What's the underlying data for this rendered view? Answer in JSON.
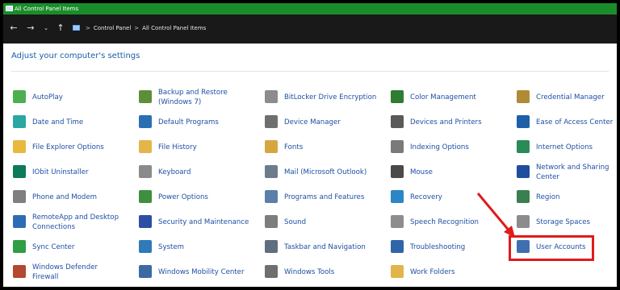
{
  "window": {
    "title": "All Control Panel Items"
  },
  "navigation": {
    "back_glyph": "←",
    "forward_glyph": "→",
    "recent_glyph": "⌄",
    "up_glyph": "↑",
    "breadcrumb": [
      "Control Panel",
      "All Control Panel Items"
    ],
    "separator": ">"
  },
  "main": {
    "heading": "Adjust your computer's settings",
    "items": [
      {
        "label": "AutoPlay",
        "label2": "",
        "icon": "autoplay-icon",
        "color": "#4caf50"
      },
      {
        "label": "Backup and Restore",
        "label2": "(Windows 7)",
        "icon": "backup-icon",
        "color": "#5d8f3a"
      },
      {
        "label": "BitLocker Drive Encryption",
        "label2": "",
        "icon": "bitlocker-icon",
        "color": "#8c8c8c"
      },
      {
        "label": "Color Management",
        "label2": "",
        "icon": "color-management-icon",
        "color": "#2e7d32"
      },
      {
        "label": "Credential Manager",
        "label2": "",
        "icon": "credential-icon",
        "color": "#b08a34"
      },
      {
        "label": "Date and Time",
        "label2": "",
        "icon": "clock-icon",
        "color": "#2aa7a1"
      },
      {
        "label": "Default Programs",
        "label2": "",
        "icon": "default-programs-icon",
        "color": "#2b6fb3"
      },
      {
        "label": "Device Manager",
        "label2": "",
        "icon": "device-manager-icon",
        "color": "#6f6f6f"
      },
      {
        "label": "Devices and Printers",
        "label2": "",
        "icon": "printer-icon",
        "color": "#5a5a5a"
      },
      {
        "label": "Ease of Access Center",
        "label2": "",
        "icon": "accessibility-icon",
        "color": "#1e5fa8"
      },
      {
        "label": "File Explorer Options",
        "label2": "",
        "icon": "folder-icon",
        "color": "#e8b93c"
      },
      {
        "label": "File History",
        "label2": "",
        "icon": "file-history-icon",
        "color": "#e3b54a"
      },
      {
        "label": "Fonts",
        "label2": "",
        "icon": "fonts-icon",
        "color": "#d7a640"
      },
      {
        "label": "Indexing Options",
        "label2": "",
        "icon": "indexing-icon",
        "color": "#7a7a7a"
      },
      {
        "label": "Internet Options",
        "label2": "",
        "icon": "internet-icon",
        "color": "#2b8b56"
      },
      {
        "label": "IObit Uninstaller",
        "label2": "",
        "icon": "iobit-icon",
        "color": "#0d7a5a"
      },
      {
        "label": "Keyboard",
        "label2": "",
        "icon": "keyboard-icon",
        "color": "#8a8a8a"
      },
      {
        "label": "Mail (Microsoft Outlook)",
        "label2": "",
        "icon": "mail-icon",
        "color": "#6c7c8c"
      },
      {
        "label": "Mouse",
        "label2": "",
        "icon": "mouse-icon",
        "color": "#4a4a4a"
      },
      {
        "label": "Network and Sharing",
        "label2": "Center",
        "icon": "network-icon",
        "color": "#1f4e9c"
      },
      {
        "label": "Phone and Modem",
        "label2": "",
        "icon": "phone-icon",
        "color": "#7f7f7f"
      },
      {
        "label": "Power Options",
        "label2": "",
        "icon": "power-icon",
        "color": "#3f8f3f"
      },
      {
        "label": "Programs and Features",
        "label2": "",
        "icon": "programs-icon",
        "color": "#5b7fa8"
      },
      {
        "label": "Recovery",
        "label2": "",
        "icon": "recovery-icon",
        "color": "#2b86c5"
      },
      {
        "label": "Region",
        "label2": "",
        "icon": "region-icon",
        "color": "#3a7f4f"
      },
      {
        "label": "RemoteApp and Desktop",
        "label2": "Connections",
        "icon": "remoteapp-icon",
        "color": "#2d6db5"
      },
      {
        "label": "Security and Maintenance",
        "label2": "",
        "icon": "security-flag-icon",
        "color": "#2c4ea3"
      },
      {
        "label": "Sound",
        "label2": "",
        "icon": "sound-icon",
        "color": "#7d7d7d"
      },
      {
        "label": "Speech Recognition",
        "label2": "",
        "icon": "microphone-icon",
        "color": "#8d8d8d"
      },
      {
        "label": "Storage Spaces",
        "label2": "",
        "icon": "storage-icon",
        "color": "#8c8c8c"
      },
      {
        "label": "Sync Center",
        "label2": "",
        "icon": "sync-icon",
        "color": "#2f9e44"
      },
      {
        "label": "System",
        "label2": "",
        "icon": "system-icon",
        "color": "#2f7ab8"
      },
      {
        "label": "Taskbar and Navigation",
        "label2": "",
        "icon": "taskbar-icon",
        "color": "#5f6f7f"
      },
      {
        "label": "Troubleshooting",
        "label2": "",
        "icon": "troubleshooting-icon",
        "color": "#2f66a8"
      },
      {
        "label": "User Accounts",
        "label2": "",
        "icon": "user-accounts-icon",
        "color": "#3f6fb0"
      },
      {
        "label": "Windows Defender",
        "label2": "Firewall",
        "icon": "firewall-icon",
        "color": "#b4472f"
      },
      {
        "label": "Windows Mobility Center",
        "label2": "",
        "icon": "mobility-icon",
        "color": "#3c6aa3"
      },
      {
        "label": "Windows Tools",
        "label2": "",
        "icon": "tools-icon",
        "color": "#6f6f6f"
      },
      {
        "label": "Work Folders",
        "label2": "",
        "icon": "work-folders-icon",
        "color": "#e1b54a"
      }
    ]
  },
  "annotation": {
    "highlight_target": "User Accounts",
    "color": "#e01b1b"
  }
}
